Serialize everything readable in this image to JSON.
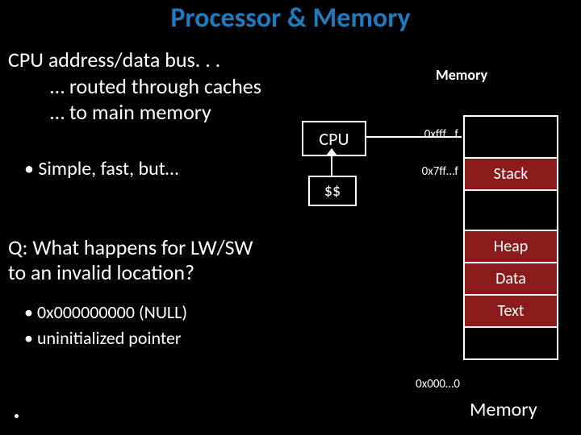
{
  "title": "Processor & Memory",
  "bullets": {
    "l0": "CPU address/data bus. . .",
    "l1a": "… routed through caches",
    "l1b": "… to main memory"
  },
  "sub": "Simple, fast, but…",
  "question_l1": "Q: What happens for LW/SW",
  "question_l2": "to an invalid location?",
  "subbullets": {
    "a": "0x000000000 (NULL)",
    "b": "uninitialized pointer"
  },
  "diagram": {
    "mem_heading": "Memory",
    "cpu": "CPU",
    "cache": "$$",
    "addr_top": "0xfff…f",
    "addr_stack": "0x7ff…f",
    "addr_bottom": "0x000…0",
    "seg_stack": "Stack",
    "seg_heap": "Heap",
    "seg_data": "Data",
    "seg_text": "Text",
    "caption": "Memory"
  }
}
